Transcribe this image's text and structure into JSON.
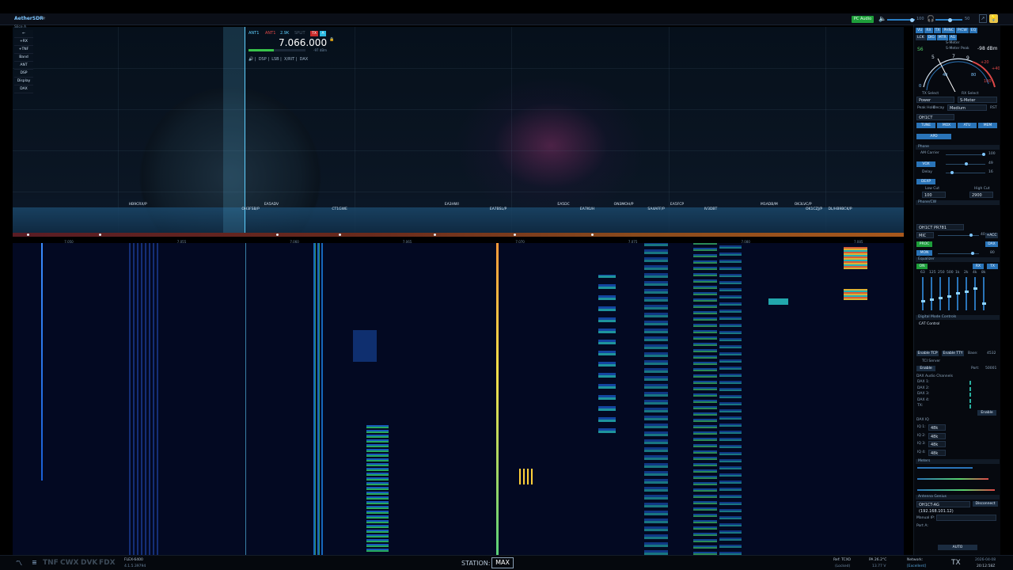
{
  "app": {
    "title": "AetherSDR"
  },
  "titlebar": {
    "pc_audio": "PC Audio",
    "vol_left": "100",
    "vol_right": "50"
  },
  "left_menu": {
    "slice_label": "Slice A",
    "items": [
      "←",
      "+RX",
      "+TNF",
      "Band",
      "ANT",
      "DSP",
      "Display",
      "DAX"
    ]
  },
  "vfo": {
    "rx_ant": "ANT1",
    "tx_ant": "ANT1",
    "bandwidth": "2.9K",
    "split": "SPLIT",
    "frequency": "7.066.000",
    "tx_flag": "TX",
    "slice_letter": "A",
    "dbm": "-97 dBm",
    "tabs": [
      "DSP",
      "LSB",
      "X/RIT",
      "DAX"
    ],
    "smeter_level": 0.45
  },
  "spots": [
    {
      "call": "HB9CRX/P",
      "freq": 7.053
    },
    {
      "call": "OH3FSB/P",
      "freq": 7.058
    },
    {
      "call": "EA5ADV",
      "freq": 7.059
    },
    {
      "call": "CT1GWE",
      "freq": 7.062
    },
    {
      "call": "EA3HWI",
      "freq": 7.067
    },
    {
      "call": "EA7BSL/P",
      "freq": 7.069
    },
    {
      "call": "EA5DC",
      "freq": 7.072
    },
    {
      "call": "EA7KUH",
      "freq": 7.073
    },
    {
      "call": "ON3MOH/P",
      "freq": 7.0745
    },
    {
      "call": "SA4AFF/P",
      "freq": 7.076
    },
    {
      "call": "EA5FCP",
      "freq": 7.077
    },
    {
      "call": "IV3DBT",
      "freq": 7.0785
    },
    {
      "call": "M1ADB/M",
      "freq": 7.081
    },
    {
      "call": "OK1CZJ/P",
      "freq": 7.083
    },
    {
      "call": "OK3LVC/P",
      "freq": 7.0825
    },
    {
      "call": "DL/HB9BCK/P",
      "freq": 7.084
    }
  ],
  "freq_scale": {
    "labels": [
      "7.050",
      "7.055",
      "7.060",
      "7.065",
      "7.070",
      "7.075",
      "7.080",
      "7.085"
    ]
  },
  "bottombar": {
    "modes": [
      "TNF",
      "CWX",
      "DVK",
      "FDX"
    ],
    "radio_model": "FLEX-6400",
    "radio_version": "4.1.5.39794",
    "station_label": "STATION:",
    "station_value": "MAX",
    "ref": "Ref: TCXO",
    "ref_status": "(Locked)",
    "pa_temp": "PA 26.2°C",
    "voltage": "13.77 V",
    "network_label": "Network:",
    "network_status": "[Excellent]",
    "tx": "TX",
    "date": "2026-04-08",
    "time": "20:12:58Z"
  },
  "right_panel": {
    "tabs_row1": [
      "VU",
      "RX",
      "TX",
      "PHNC",
      "P/CW",
      "EQ"
    ],
    "tabs_row2": [
      "LCK",
      "DIG",
      "MTR",
      "AG"
    ],
    "meter": {
      "title": "S-Meter",
      "peak_label": "S-Meter Peak",
      "s_value": "S6",
      "dbm": "-98 dBm"
    },
    "tx_select_label": "TX Select",
    "rx_select_label": "RX Select",
    "tx_select": "Power",
    "rx_select": "S-Meter",
    "peak_hold": "Peak Hold",
    "decay": "Decay",
    "decay_value": "Medium",
    "rst": "RST",
    "profile": "OH1CT",
    "tx_buttons": [
      "TUNE",
      "MOX",
      "ATU",
      "MEM"
    ],
    "apd": "APD",
    "phone_label": "Phone",
    "am_carrier": "AM Carrier",
    "am_carrier_value": "100",
    "vox": "VOX",
    "vox_value": "49",
    "delay": "Delay",
    "delay_value": "16",
    "dexp": "DEXP",
    "low_cut": "Low Cut",
    "high_cut": "High Cut",
    "low_cut_value": "100",
    "high_cut_value": "2900",
    "phone_cw_label": "Phone/CW",
    "mic_profile": "OH1CT PR781",
    "mic": "MIC",
    "mic_value": "40",
    "acc": "+ACC",
    "proc": "PROC",
    "dax": "DAX",
    "mon": "MON",
    "mon_value": "80",
    "equalizer_label": "Equalizer",
    "eq_on": "ON",
    "eq_rx": "RX",
    "eq_tx": "TX",
    "eq_bands": [
      "63",
      "125",
      "250",
      "500",
      "1k",
      "2k",
      "4k",
      "8k"
    ],
    "eq_levels": [
      0.3,
      0.35,
      0.4,
      0.45,
      0.55,
      0.6,
      0.7,
      0.25
    ],
    "digital_label": "Digital Mode Controls",
    "cat_control": "CAT Control",
    "enable_tcp": "Enable TCP",
    "enable_tty": "Enable TTY",
    "base": "Base:",
    "base_value": "4532",
    "tci_server": "TCI Server",
    "enable": "Enable",
    "port": "Port:",
    "port_value": "50001",
    "dax_audio": "DAX Audio Channels",
    "dax_rows": [
      "DAX 1:",
      "DAX 2:",
      "DAX 3:",
      "DAX 4:",
      "TX:"
    ],
    "dax_enable": "Enable",
    "dax_iq": "DAX IQ",
    "iq_rows": [
      "IQ 1:",
      "IQ 2:",
      "IQ 3:",
      "IQ 4:"
    ],
    "iq_rate": "48k",
    "radio_hw": "Meters",
    "antenna_genius": "Antenna Genius",
    "ag_device": "OH1CT-AG (192.168.101.12)",
    "disconnect": "Disconnect",
    "manual_ip": "Manual IP:",
    "port_a": "Port A:",
    "auto": "AUTO"
  },
  "colors": {
    "accent": "#2a74b8",
    "green": "#1e9e3a",
    "tx_red": "#c92a2a",
    "freq_scale": "#a8581c"
  }
}
